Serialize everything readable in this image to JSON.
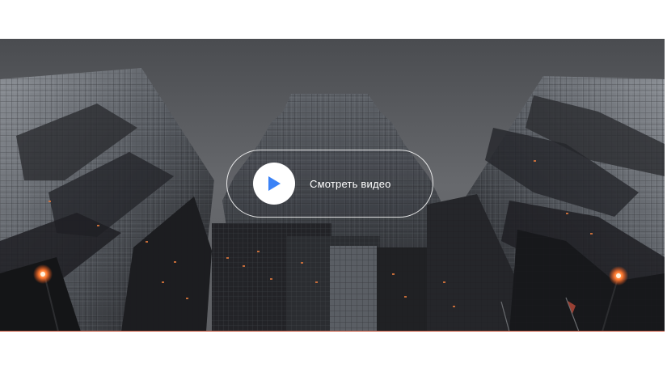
{
  "hero": {
    "video_label": "Смотреть видео",
    "play_icon": "play-icon"
  },
  "colors": {
    "accent": "#3b82f6",
    "sky": "#585a5e",
    "bottom_line": "#c8553d"
  }
}
